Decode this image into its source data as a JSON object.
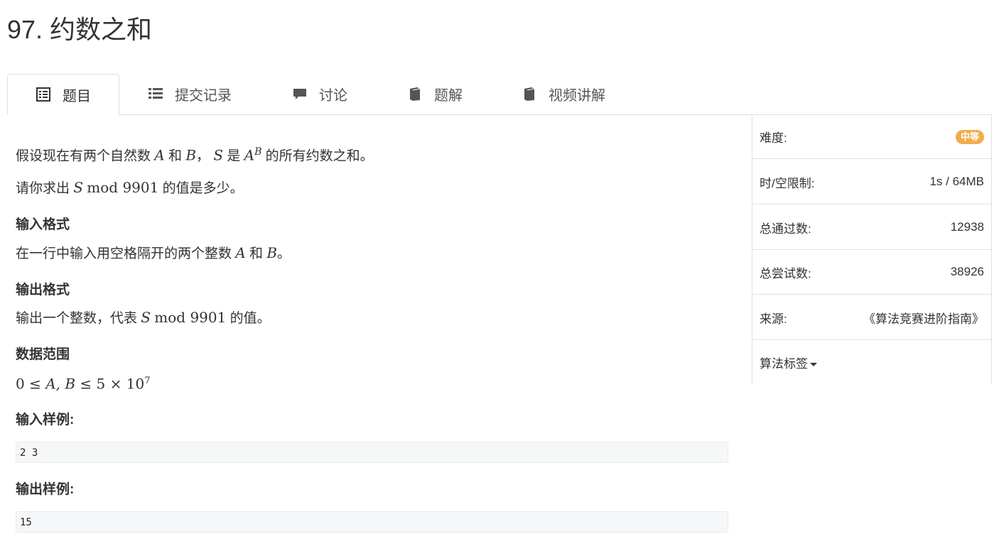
{
  "problem": {
    "title": "97. 约数之和"
  },
  "tabs": [
    {
      "label": "题目",
      "icon": "list-alt-icon"
    },
    {
      "label": "提交记录",
      "icon": "list-icon"
    },
    {
      "label": "讨论",
      "icon": "comment-icon"
    },
    {
      "label": "题解",
      "icon": "book-icon"
    },
    {
      "label": "视频讲解",
      "icon": "book-icon"
    }
  ],
  "statement": {
    "p1_a": "假设现在有两个自然数",
    "var_A": "A",
    "and": "和",
    "var_B": "B",
    "comma": "，",
    "var_S": "S",
    "is": "是",
    "power_base": "A",
    "power_exp": "B",
    "p1_end": "的所有约数之和。",
    "p2_a": "请你求出",
    "mod_expr": "mod 9901",
    "p2_end": "的值是多少。"
  },
  "input_format": {
    "heading": "输入格式",
    "text_a": "在一行中输入用空格隔开的两个整数",
    "end": "。"
  },
  "output_format": {
    "heading": "输出格式",
    "text_a": "输出一个整数，代表",
    "end": "的值。"
  },
  "data_range": {
    "heading": "数据范围",
    "expr_a": "0 ≤ ",
    "expr_vars": "A, B",
    "expr_b": " ≤ 5 × 10",
    "expr_exp": "7"
  },
  "sample_input": {
    "heading": "输入样例:",
    "value": "2 3"
  },
  "sample_output": {
    "heading": "输出样例:",
    "value": "15"
  },
  "sidebar": {
    "difficulty_label": "难度:",
    "difficulty_value": "中等",
    "limit_label": "时/空限制:",
    "limit_value": "1s / 64MB",
    "passed_label": "总通过数:",
    "passed_value": "12938",
    "tried_label": "总尝试数:",
    "tried_value": "38926",
    "source_label": "来源:",
    "source_value": "《算法竞赛进阶指南》",
    "tags_label": "算法标签"
  },
  "colors": {
    "badge": "#f0ad4e",
    "code_bg": "#f6f7f8"
  }
}
